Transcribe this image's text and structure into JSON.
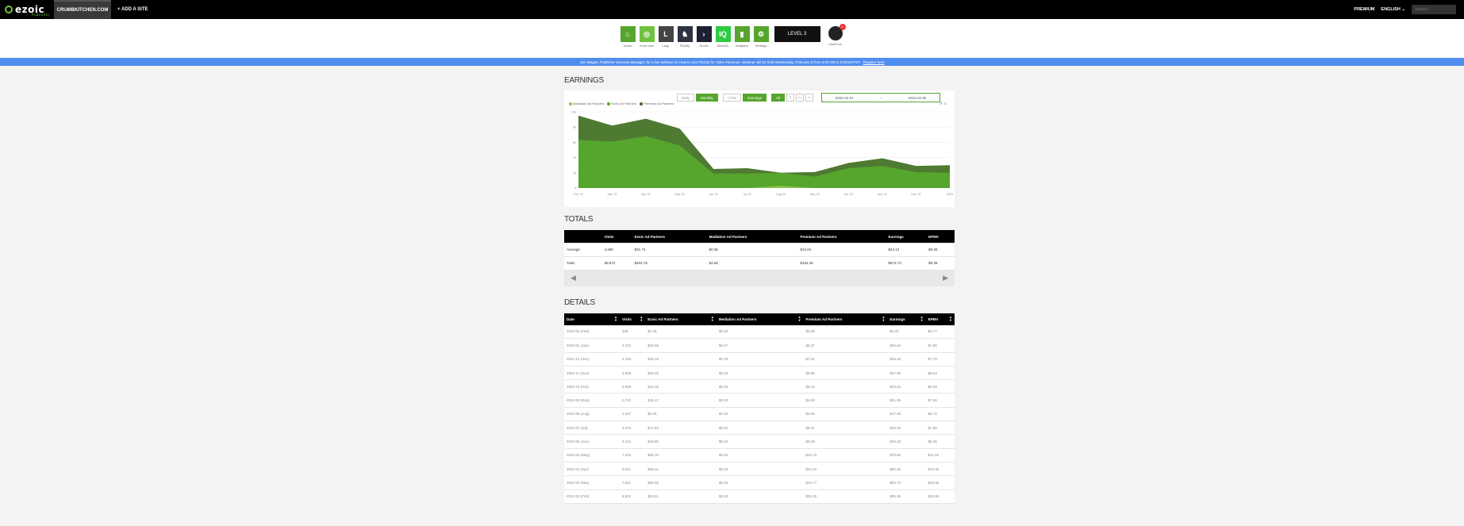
{
  "topbar": {
    "logo": "ezoic",
    "logo_sub": "Publisher",
    "site": "CRUMBKITCHEN.COM",
    "add_site": "+ ADD A SITE",
    "premium": "PREMIUM",
    "language": "ENGLISH",
    "search_placeholder": "Search..."
  },
  "nav": [
    {
      "label": "Home",
      "icon": "home-icon",
      "color": "#56a52d",
      "glyph": "⌂"
    },
    {
      "label": "Ezoic Ads",
      "icon": "ezoic-ads-icon",
      "color": "#6fc23f",
      "glyph": "◎"
    },
    {
      "label": "Leap",
      "icon": "leap-icon",
      "color": "#444444",
      "glyph": "L"
    },
    {
      "label": "Flickify",
      "icon": "flickify-icon",
      "color": "#2d3440",
      "glyph": "♞"
    },
    {
      "label": "Humix",
      "icon": "humix-icon",
      "color": "#1c2030",
      "glyph": "›"
    },
    {
      "label": "NicheIQ",
      "icon": "nicheiq-icon",
      "color": "#2ecc40",
      "glyph": "IQ"
    },
    {
      "label": "Analytics",
      "icon": "analytics-icon",
      "color": "#56a52d",
      "glyph": "▮"
    },
    {
      "label": "Settings",
      "icon": "gear-icon",
      "color": "#56a52d",
      "glyph": "⚙"
    }
  ],
  "banner_text": "LEVEL 3",
  "cashcow": {
    "label": "CashCow",
    "badge": "1"
  },
  "announcement": {
    "text": "Join Megan, Publisher Success Manager, for a live webinar on How to Use Flickify for Video Revenue. Webinar will be held Wednesday, February 8 from 9:00 AM to 9:30AM PST.",
    "link": "Register here"
  },
  "earnings": {
    "title": "EARNINGS",
    "buttons": {
      "daily": "Daily",
      "monthly": "Monthly",
      "ctr": "CTRs",
      "earnings": "Earnings",
      "all": "All"
    },
    "date_from": "2022-02-01",
    "date_to": "2023-02-05",
    "legend": [
      "Mediation Ad Partners",
      "Ezoic Ad Partners",
      "Premium Ad Partners"
    ],
    "legend_colors": [
      "#8bc34a",
      "#56a52d",
      "#3f6b2a"
    ]
  },
  "chart_data": {
    "type": "area",
    "categories": [
      "Feb '22",
      "Mar '22",
      "Apr '22",
      "May '22",
      "Jun '22",
      "Jul '22",
      "Aug '22",
      "Sep '22",
      "Oct '22",
      "Nov '22",
      "Dec '22",
      "2023"
    ],
    "yticks": [
      "100",
      "80",
      "60",
      "40",
      "20",
      "0"
    ],
    "ylim": [
      0,
      100
    ],
    "series": [
      {
        "name": "Mediation Ad Partners",
        "color": "#8bc34a",
        "values": [
          0,
          0,
          0,
          0,
          0,
          0,
          3,
          0,
          0,
          0,
          0,
          0
        ]
      },
      {
        "name": "Ezoic Ad Partners",
        "color": "#56a52d",
        "values": [
          63,
          61,
          68,
          56,
          19,
          19,
          17,
          15,
          26,
          29,
          21,
          20
        ]
      },
      {
        "name": "Premium Ad Partners",
        "color": "#4e7a31",
        "values": [
          32,
          21,
          23,
          22,
          6,
          7,
          0,
          6,
          7,
          10,
          8,
          10
        ]
      }
    ]
  },
  "totals": {
    "title": "TOTALS",
    "headers": [
      "",
      "Visits",
      "Ezoic Ad Partners",
      "Mediation Ad Partners",
      "Premium Ad Partners",
      "Earnings",
      "EPMV"
    ],
    "rows": [
      [
        "Average:",
        "4,685",
        "$31.74",
        "$0.36",
        "$12.04",
        "$44.12",
        "$9.38"
      ],
      [
        "Total:",
        "58,873",
        "$404.76",
        "$4.66",
        "$164.38",
        "$573.73",
        "$9.38"
      ]
    ]
  },
  "details": {
    "title": "DETAILS",
    "headers": [
      "Date",
      "Visits",
      "Ezoic Ad Partners",
      "Mediation Ad Partners",
      "Premium Ad Partners",
      "Earnings",
      "EPMV"
    ],
    "rows": [
      [
        "2023-02 (Feb)",
        "338",
        "$2.48",
        "$0.03",
        "$0.58",
        "$3.22",
        "$9.77"
      ],
      [
        "2023-01 (Jan)",
        "3,703",
        "$20.06",
        "$0.27",
        "$0.37",
        "$25.64",
        "$7.86"
      ],
      [
        "2022-12 (Dec)",
        "3,766",
        "$20.18",
        "$0.78",
        "$7.31",
        "$28.18",
        "$7.75"
      ],
      [
        "2022-11 (Nov)",
        "3,938",
        "$28.33",
        "$0.03",
        "$9.60",
        "$37.95",
        "$9.63"
      ],
      [
        "2022-10 (Oct)",
        "3,558",
        "$24.18",
        "$0.03",
        "$8.14",
        "$33.22",
        "$9.28"
      ],
      [
        "2022-09 (Sep)",
        "2,743",
        "$16.17",
        "$0.03",
        "$4.84",
        "$21.05",
        "$7.65"
      ],
      [
        "2022-08 (Aug)",
        "2,537",
        "$0.36",
        "$0.33",
        "$3.05",
        "$17.05",
        "$6.72"
      ],
      [
        "2022-07 (Jul)",
        "3,375",
        "$17.83",
        "$0.03",
        "$8.32",
        "$26.33",
        "$7.80"
      ],
      [
        "2022-06 (Jun)",
        "3,113",
        "$16.80",
        "$0.03",
        "$9.29",
        "$26.18",
        "$8.35"
      ],
      [
        "2022-05 (May)",
        "7,003",
        "$55.70",
        "$0.03",
        "$22.73",
        "$78.80",
        "$11.26"
      ],
      [
        "2022-04 (Apr)",
        "9,011",
        "$68.11",
        "$0.03",
        "$24.22",
        "$92.36",
        "$10.25"
      ],
      [
        "2022-03 (Mar)",
        "7,661",
        "$60.33",
        "$0.03",
        "$22.77",
        "$83.73",
        "$10.86"
      ],
      [
        "2022-02 (Feb)",
        "8,801",
        "$63.51",
        "$0.03",
        "$32.30",
        "$95.30",
        "$10.56"
      ]
    ]
  }
}
